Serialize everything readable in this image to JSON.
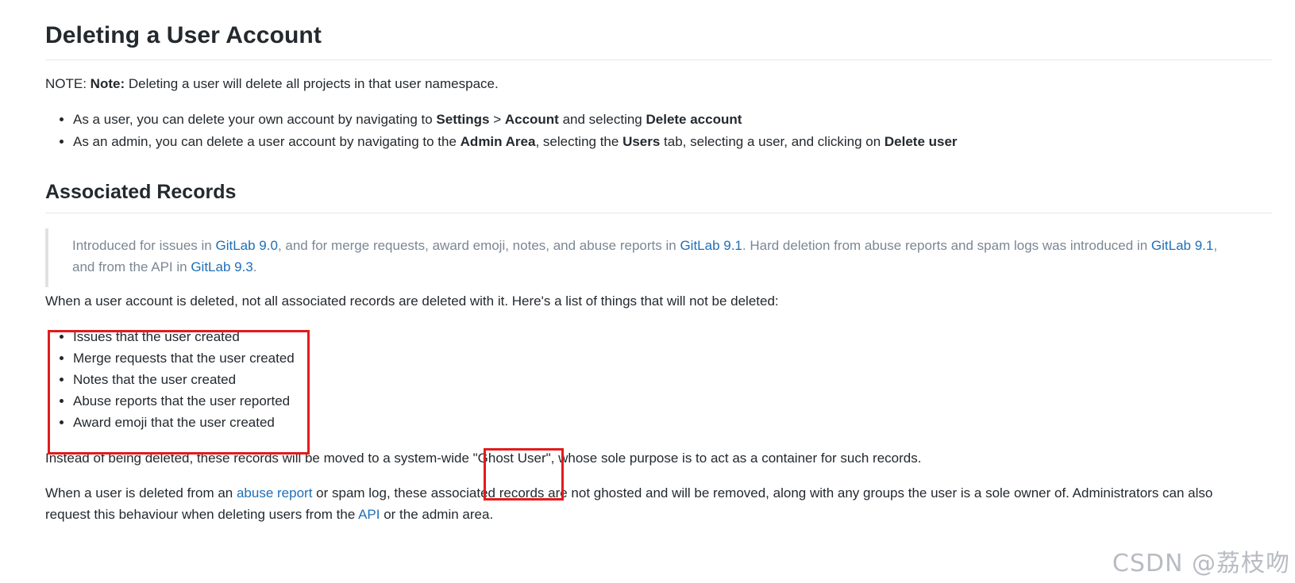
{
  "heading_delete": "Deleting a User Account",
  "note": {
    "prefix": "NOTE: ",
    "bold": "Note:",
    "text": " Deleting a user will delete all projects in that user namespace."
  },
  "delete_bullets": [
    {
      "t1": "As a user, you can delete your own account by navigating to ",
      "b1": "Settings",
      "t2": " > ",
      "b2": "Account",
      "t3": " and selecting ",
      "b3": "Delete account"
    },
    {
      "t1": "As an admin, you can delete a user account by navigating to the ",
      "b1": "Admin Area",
      "t2": ", selecting the ",
      "b2": "Users",
      "t3": " tab, selecting a user, and clicking on ",
      "b3": "Delete user"
    }
  ],
  "heading_records": "Associated Records",
  "quote": {
    "t1": "Introduced for issues in ",
    "l1": "GitLab 9.0",
    "t2": ", and for merge requests, award emoji, notes, and abuse reports in ",
    "l2": "GitLab 9.1",
    "t3": ". Hard deletion from abuse reports and spam logs was introduced in ",
    "l3": "GitLab 9.1",
    "t4": ",",
    "t5": "and from the API in ",
    "l4": "GitLab 9.3",
    "t6": "."
  },
  "intro_text": "When a user account is deleted, not all associated records are deleted with it. Here's a list of things that will not be deleted:",
  "kept_items": [
    "Issues that the user created",
    "Merge requests that the user created",
    "Notes that the user created",
    "Abuse reports that the user reported",
    "Award emoji that the user created"
  ],
  "ghost_text": {
    "t1": "Instead of being deleted, these records will be moved to a system-wide ",
    "ghost": "\"Ghost User\"",
    "t2": ", whose sole purpose is to act as a container for such records."
  },
  "abuse_para": {
    "t1": "When a user is deleted from an ",
    "l1": "abuse report",
    "t2": " or spam log, these associated records are not ghosted and will be removed, along with any groups the user is a sole owner of. Administrators can also",
    "t3": "request this behaviour when deleting users from the ",
    "l2": "API",
    "t4": " or the admin area."
  },
  "watermark": "CSDN @荔枝吻",
  "colors": {
    "link": "#1f6fb5",
    "highlight_box": "#e31b1b",
    "quote_text": "#7b8794"
  }
}
